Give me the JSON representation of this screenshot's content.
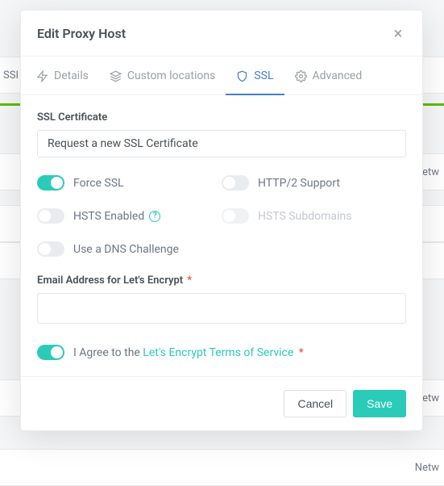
{
  "background": {
    "row_left": "SSI",
    "rows": [
      "Netw",
      "Netw"
    ]
  },
  "modal": {
    "title": "Edit Proxy Host",
    "tabs": {
      "details": "Details",
      "custom": "Custom locations",
      "ssl": "SSL",
      "advanced": "Advanced"
    },
    "ssl": {
      "cert_label": "SSL Certificate",
      "cert_value": "Request a new SSL Certificate",
      "force_ssl": "Force SSL",
      "http2": "HTTP/2 Support",
      "hsts": "HSTS Enabled",
      "hsts_sub": "HSTS Subdomains",
      "dns": "Use a DNS Challenge",
      "email_label": "Email Address for Let's Encrypt",
      "agree_prefix": "I Agree to the ",
      "agree_link": "Let's Encrypt Terms of Service",
      "star": "*"
    },
    "footer": {
      "cancel": "Cancel",
      "save": "Save"
    }
  }
}
